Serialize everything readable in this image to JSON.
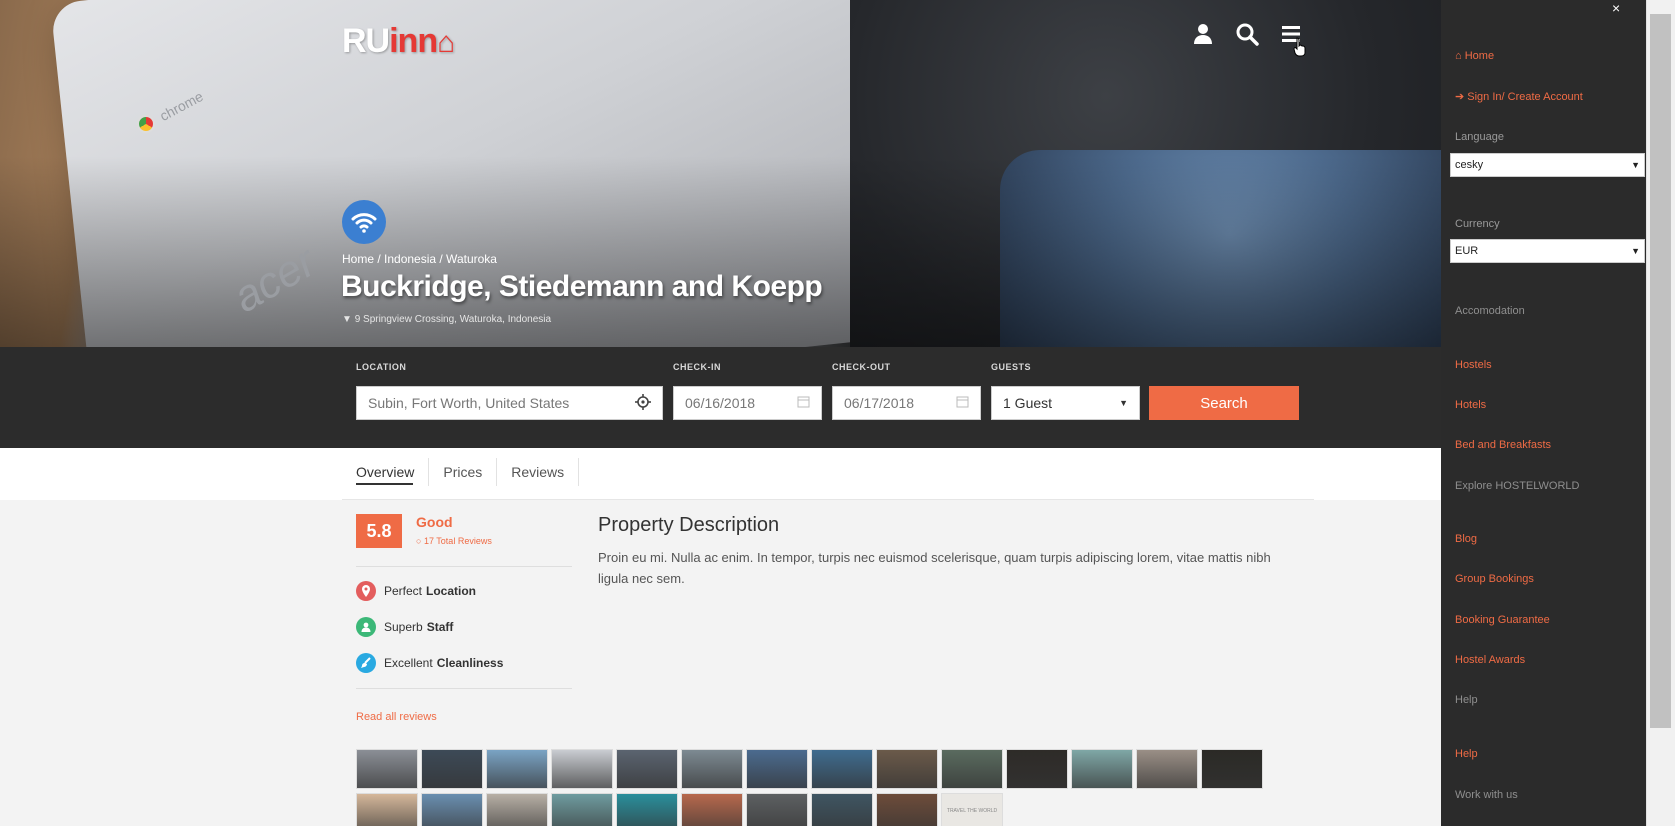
{
  "header": {
    "logo_ru": "RU",
    "logo_inn": "inn",
    "icons": [
      "user-icon",
      "search-icon",
      "menu-icon"
    ]
  },
  "hero": {
    "laptop_brand_1": "chrome",
    "laptop_brand_2": "acer",
    "breadcrumb": "Home / Indonesia / Waturoka",
    "title": "Buckridge, Stiedemann and Koepp",
    "address": "9 Springview Crossing, Waturoka, Indonesia"
  },
  "search": {
    "location_label": "LOCATION",
    "location_value": "Subin, Fort Worth, United States",
    "checkin_label": "CHECK-IN",
    "checkin_value": "06/16/2018",
    "checkout_label": "CHECK-OUT",
    "checkout_value": "06/17/2018",
    "guests_label": "GUESTS",
    "guests_value": "1 Guest",
    "button": "Search"
  },
  "tabs": [
    "Overview",
    "Prices",
    "Reviews"
  ],
  "rating": {
    "score": "5.8",
    "word": "Good",
    "reviews": "17 Total Reviews",
    "features": [
      {
        "adj": "Perfect",
        "topic": "Location",
        "color": "#e35d5d"
      },
      {
        "adj": "Superb",
        "topic": "Staff",
        "color": "#3cb878"
      },
      {
        "adj": "Excellent",
        "topic": "Cleanliness",
        "color": "#29a9e1"
      }
    ],
    "read_all": "Read all reviews"
  },
  "description": {
    "title": "Property Description",
    "text": "Proin eu mi. Nulla ac enim. In tempor, turpis nec euismod scelerisque, quam turpis adipiscing lorem, vitae mattis nibh ligula nec sem."
  },
  "gallery": {
    "colors": [
      "#8b8f96",
      "#3d4a57",
      "#7aa3c4",
      "#c9ccd1",
      "#5b6470",
      "#7d8a92",
      "#4b6b8f",
      "#3f6c8f",
      "#6b5a4a",
      "#5a6b5f",
      "#2e2b28",
      "#7fa7a6",
      "#9a8f86",
      "#2b2a26",
      "#d5b79a",
      "#6a8fb0",
      "#b7afa5",
      "#6f9ca0",
      "#2a8f9c",
      "#b7694d",
      "#5d6062",
      "#3f5562",
      "#6d4c3a",
      "#e9e7e3"
    ],
    "last_caption": "TRAVEL THE WORLD"
  },
  "side_menu": {
    "close": "×",
    "home": "Home",
    "signin": "Sign In/ Create Account",
    "language_label": "Language",
    "language_value": "cesky",
    "currency_label": "Currency",
    "currency_value": "EUR",
    "accommodation": "Accomodation",
    "hostels": "Hostels",
    "hotels": "Hotels",
    "bnb": "Bed and Breakfasts",
    "explore": "Explore HOSTELWORLD",
    "blog": "Blog",
    "group": "Group Bookings",
    "guarantee": "Booking Guarantee",
    "awards": "Hostel Awards",
    "help_grey": "Help",
    "help": "Help",
    "work": "Work with us"
  }
}
